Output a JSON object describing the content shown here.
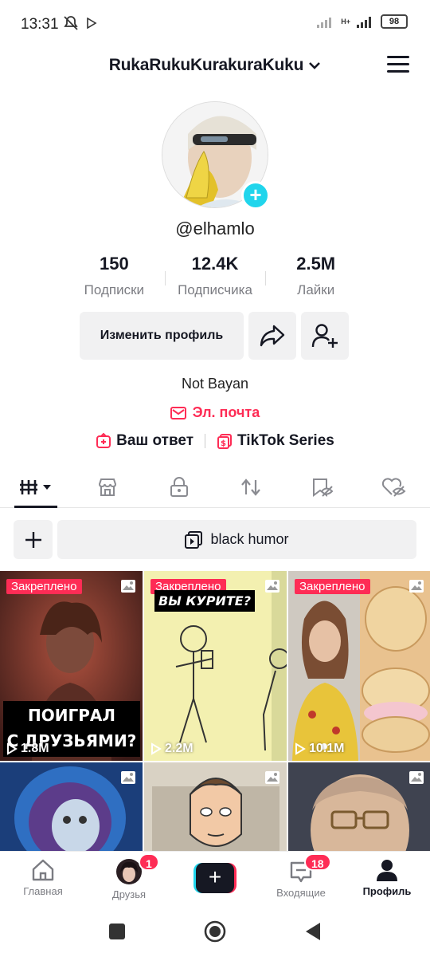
{
  "status_bar": {
    "time": "13:31",
    "network": "H+",
    "battery": "98"
  },
  "header": {
    "username": "RukaRukuKurakuraKuku"
  },
  "profile": {
    "handle": "@elhamlo",
    "stats": [
      {
        "value": "150",
        "label": "Подписки"
      },
      {
        "value": "12.4K",
        "label": "Подписчика"
      },
      {
        "value": "2.5M",
        "label": "Лайки"
      }
    ],
    "edit_button": "Изменить профиль",
    "bio": "Not Bayan",
    "email_label": "Эл. почта",
    "links": [
      {
        "label": "Ваш ответ"
      },
      {
        "label": "TikTok Series"
      }
    ]
  },
  "tabs": [
    {
      "icon": "grid-icon"
    },
    {
      "icon": "shop-icon"
    },
    {
      "icon": "lock-icon"
    },
    {
      "icon": "repost-icon"
    },
    {
      "icon": "saved-hidden-icon"
    },
    {
      "icon": "liked-hidden-icon"
    }
  ],
  "playlist": {
    "name": "black humor"
  },
  "videos": [
    {
      "pinned": "Закреплено",
      "caption": [
        "ПОИГРАЛ",
        "С ДРУЗЬЯМИ?"
      ],
      "views": "1.8M"
    },
    {
      "pinned": "Закреплено",
      "caption": [
        "ВЫ КУРИТЕ?"
      ],
      "views": "2.2M"
    },
    {
      "pinned": "Закреплено",
      "caption": [],
      "views": "10.1M"
    },
    {
      "pinned": "",
      "caption": [],
      "views": ""
    },
    {
      "pinned": "",
      "caption": [],
      "views": ""
    },
    {
      "pinned": "",
      "caption": [],
      "views": ""
    }
  ],
  "bottom_nav": [
    {
      "label": "Главная"
    },
    {
      "label": "Друзья",
      "badge": "1"
    },
    {
      "label": ""
    },
    {
      "label": "Входящие",
      "badge": "18"
    },
    {
      "label": "Профиль"
    }
  ],
  "colors": {
    "accent": "#fe2c55",
    "cyan": "#20d5ec",
    "text": "#161823",
    "muted": "#7b7c82"
  }
}
